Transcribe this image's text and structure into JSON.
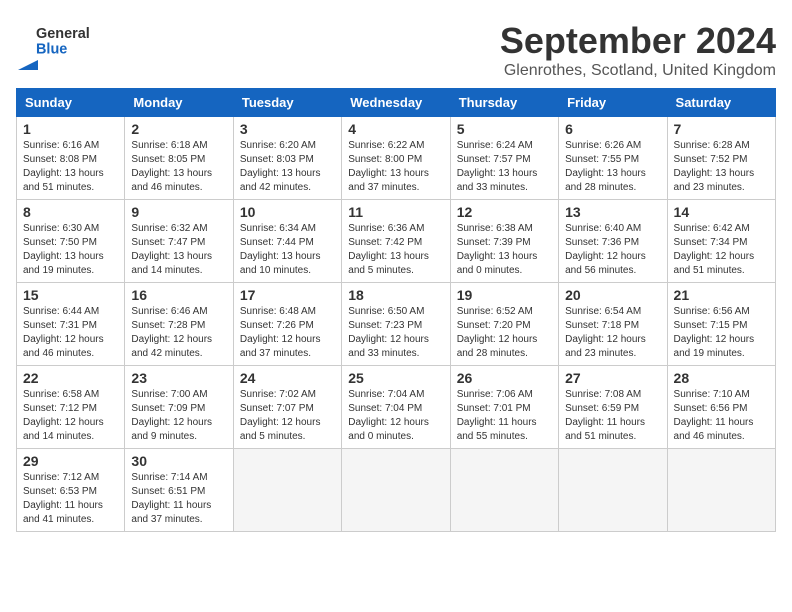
{
  "header": {
    "logo_general": "General",
    "logo_blue": "Blue",
    "title": "September 2024",
    "subtitle": "Glenrothes, Scotland, United Kingdom"
  },
  "columns": [
    "Sunday",
    "Monday",
    "Tuesday",
    "Wednesday",
    "Thursday",
    "Friday",
    "Saturday"
  ],
  "weeks": [
    [
      {
        "day": "1",
        "info": "Sunrise: 6:16 AM\nSunset: 8:08 PM\nDaylight: 13 hours\nand 51 minutes."
      },
      {
        "day": "2",
        "info": "Sunrise: 6:18 AM\nSunset: 8:05 PM\nDaylight: 13 hours\nand 46 minutes."
      },
      {
        "day": "3",
        "info": "Sunrise: 6:20 AM\nSunset: 8:03 PM\nDaylight: 13 hours\nand 42 minutes."
      },
      {
        "day": "4",
        "info": "Sunrise: 6:22 AM\nSunset: 8:00 PM\nDaylight: 13 hours\nand 37 minutes."
      },
      {
        "day": "5",
        "info": "Sunrise: 6:24 AM\nSunset: 7:57 PM\nDaylight: 13 hours\nand 33 minutes."
      },
      {
        "day": "6",
        "info": "Sunrise: 6:26 AM\nSunset: 7:55 PM\nDaylight: 13 hours\nand 28 minutes."
      },
      {
        "day": "7",
        "info": "Sunrise: 6:28 AM\nSunset: 7:52 PM\nDaylight: 13 hours\nand 23 minutes."
      }
    ],
    [
      {
        "day": "8",
        "info": "Sunrise: 6:30 AM\nSunset: 7:50 PM\nDaylight: 13 hours\nand 19 minutes."
      },
      {
        "day": "9",
        "info": "Sunrise: 6:32 AM\nSunset: 7:47 PM\nDaylight: 13 hours\nand 14 minutes."
      },
      {
        "day": "10",
        "info": "Sunrise: 6:34 AM\nSunset: 7:44 PM\nDaylight: 13 hours\nand 10 minutes."
      },
      {
        "day": "11",
        "info": "Sunrise: 6:36 AM\nSunset: 7:42 PM\nDaylight: 13 hours\nand 5 minutes."
      },
      {
        "day": "12",
        "info": "Sunrise: 6:38 AM\nSunset: 7:39 PM\nDaylight: 13 hours\nand 0 minutes."
      },
      {
        "day": "13",
        "info": "Sunrise: 6:40 AM\nSunset: 7:36 PM\nDaylight: 12 hours\nand 56 minutes."
      },
      {
        "day": "14",
        "info": "Sunrise: 6:42 AM\nSunset: 7:34 PM\nDaylight: 12 hours\nand 51 minutes."
      }
    ],
    [
      {
        "day": "15",
        "info": "Sunrise: 6:44 AM\nSunset: 7:31 PM\nDaylight: 12 hours\nand 46 minutes."
      },
      {
        "day": "16",
        "info": "Sunrise: 6:46 AM\nSunset: 7:28 PM\nDaylight: 12 hours\nand 42 minutes."
      },
      {
        "day": "17",
        "info": "Sunrise: 6:48 AM\nSunset: 7:26 PM\nDaylight: 12 hours\nand 37 minutes."
      },
      {
        "day": "18",
        "info": "Sunrise: 6:50 AM\nSunset: 7:23 PM\nDaylight: 12 hours\nand 33 minutes."
      },
      {
        "day": "19",
        "info": "Sunrise: 6:52 AM\nSunset: 7:20 PM\nDaylight: 12 hours\nand 28 minutes."
      },
      {
        "day": "20",
        "info": "Sunrise: 6:54 AM\nSunset: 7:18 PM\nDaylight: 12 hours\nand 23 minutes."
      },
      {
        "day": "21",
        "info": "Sunrise: 6:56 AM\nSunset: 7:15 PM\nDaylight: 12 hours\nand 19 minutes."
      }
    ],
    [
      {
        "day": "22",
        "info": "Sunrise: 6:58 AM\nSunset: 7:12 PM\nDaylight: 12 hours\nand 14 minutes."
      },
      {
        "day": "23",
        "info": "Sunrise: 7:00 AM\nSunset: 7:09 PM\nDaylight: 12 hours\nand 9 minutes."
      },
      {
        "day": "24",
        "info": "Sunrise: 7:02 AM\nSunset: 7:07 PM\nDaylight: 12 hours\nand 5 minutes."
      },
      {
        "day": "25",
        "info": "Sunrise: 7:04 AM\nSunset: 7:04 PM\nDaylight: 12 hours\nand 0 minutes."
      },
      {
        "day": "26",
        "info": "Sunrise: 7:06 AM\nSunset: 7:01 PM\nDaylight: 11 hours\nand 55 minutes."
      },
      {
        "day": "27",
        "info": "Sunrise: 7:08 AM\nSunset: 6:59 PM\nDaylight: 11 hours\nand 51 minutes."
      },
      {
        "day": "28",
        "info": "Sunrise: 7:10 AM\nSunset: 6:56 PM\nDaylight: 11 hours\nand 46 minutes."
      }
    ],
    [
      {
        "day": "29",
        "info": "Sunrise: 7:12 AM\nSunset: 6:53 PM\nDaylight: 11 hours\nand 41 minutes."
      },
      {
        "day": "30",
        "info": "Sunrise: 7:14 AM\nSunset: 6:51 PM\nDaylight: 11 hours\nand 37 minutes."
      },
      {
        "day": "",
        "info": ""
      },
      {
        "day": "",
        "info": ""
      },
      {
        "day": "",
        "info": ""
      },
      {
        "day": "",
        "info": ""
      },
      {
        "day": "",
        "info": ""
      }
    ]
  ]
}
